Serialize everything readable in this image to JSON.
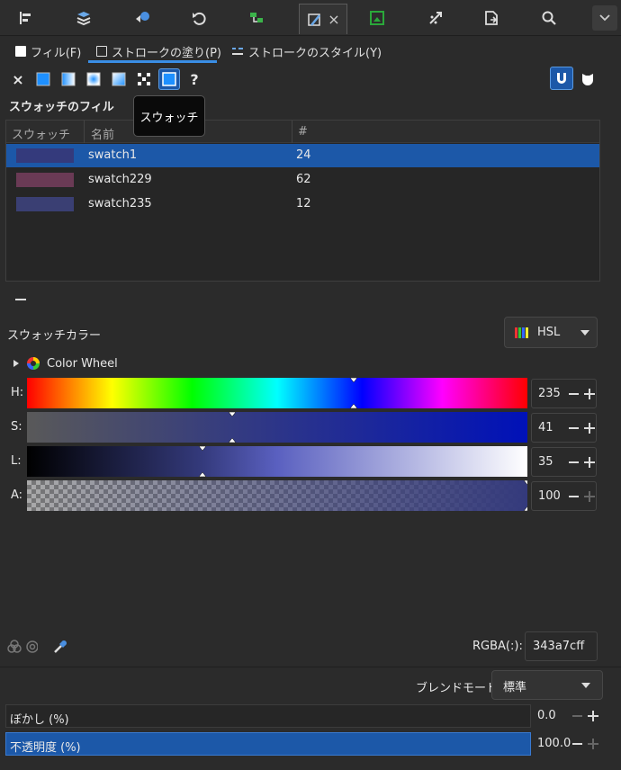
{
  "toolbar": {
    "buttons": [
      "align-icon",
      "layers-icon",
      "object-properties-icon",
      "undo-history-icon",
      "xml-editor-icon",
      "fill-stroke-icon",
      "export-icon",
      "transform-icon",
      "document-properties-icon",
      "search-icon"
    ],
    "active_close": "×"
  },
  "tabs": {
    "fill": "フィル(F)",
    "stroke_paint": "ストロークの塗り(P)",
    "stroke_style": "ストロークのスタイル(Y)"
  },
  "paint": {
    "none_glyph": "×",
    "unset_glyph": "?",
    "tooltip": "スウォッチ"
  },
  "swatch_section": {
    "title": "スウォッチのフィル",
    "columns": {
      "swatch": "スウォッチ",
      "name": "名前",
      "count": "#"
    },
    "rows": [
      {
        "name": "swatch1",
        "count": "24",
        "color": "#343a7c"
      },
      {
        "name": "swatch229",
        "count": "62",
        "color": "#6a3a55"
      },
      {
        "name": "swatch235",
        "count": "12",
        "color": "#3a3f73"
      }
    ]
  },
  "swatch_color": {
    "label": "スウォッチカラー",
    "mode": "HSL",
    "wheel_label": "Color Wheel"
  },
  "sliders": {
    "h": {
      "label": "H:",
      "value": "235",
      "level": 0.653
    },
    "s": {
      "label": "S:",
      "value": "41",
      "level": 0.41
    },
    "l": {
      "label": "L:",
      "value": "35",
      "level": 0.35
    },
    "a": {
      "label": "A:",
      "value": "100",
      "level": 1.0
    }
  },
  "rgba": {
    "label": "RGBA(:):",
    "value": "343a7cff"
  },
  "blend": {
    "label": "ブレンドモード:",
    "value": "標準"
  },
  "blur": {
    "label": "ぼかし (%)",
    "value": "0.0",
    "level": 0.0
  },
  "opacity": {
    "label": "不透明度 (%)",
    "value": "100.0",
    "level": 1.0
  },
  "colors": {
    "accent": "#3a8ee6",
    "selection": "#1c58a8"
  }
}
